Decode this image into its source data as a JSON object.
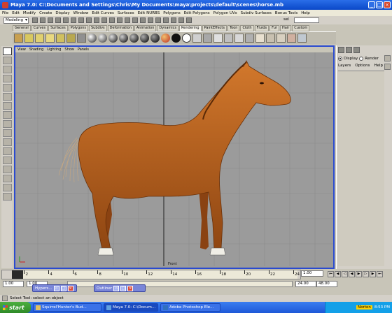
{
  "window": {
    "title": "Maya 7.0: C:\\Documents and Settings\\Chris\\My Documents\\maya\\projects\\default\\scenes\\horse.mb"
  },
  "menubar": [
    "File",
    "Edit",
    "Modify",
    "Create",
    "Display",
    "Window",
    "Edit Curves",
    "Surfaces",
    "Edit NURBS",
    "Polygons",
    "Edit Polygons",
    "Polygon UVs",
    "Subdiv Surfaces",
    "Bonus Tools",
    "Help"
  ],
  "statusline": {
    "mode": "Modeling",
    "set_label": "sel",
    "set_value": ""
  },
  "shelf_tabs": [
    "General",
    "Curves",
    "Surfaces",
    "Polygons",
    "Subdivs",
    "Deformation",
    "Animation",
    "Dynamics",
    "Rendering",
    "PaintEffects",
    "Toon",
    "Cloth",
    "Fluids",
    "Fur",
    "Hair",
    "Custom"
  ],
  "active_shelf_tab": "Rendering",
  "viewport": {
    "menu": [
      "View",
      "Shading",
      "Lighting",
      "Show",
      "Panels"
    ],
    "camera_label": "Front"
  },
  "channel_box": {
    "display_label": "Display",
    "render_label": "Render",
    "menu": [
      "Layers",
      "Options",
      "Help"
    ]
  },
  "time_slider": {
    "ticks": [
      "2",
      "4",
      "6",
      "8",
      "10",
      "12",
      "14",
      "16",
      "18",
      "20",
      "22",
      "24"
    ],
    "current_time": "1.00"
  },
  "range_slider": {
    "start": "1.00",
    "playback_start": "1.00",
    "playback_end": "24.00",
    "end": "48.00"
  },
  "minimized_windows": [
    {
      "label": "Hypers..."
    },
    {
      "label": "Outliner"
    }
  ],
  "helpline": {
    "text": "Select Tool: select an object"
  },
  "taskbar": {
    "start_label": "start",
    "items": [
      {
        "label": "Squirrel'Hunter's Bud..."
      },
      {
        "label": "Maya 7.0: C:\\Docum..."
      },
      {
        "label": "Adobe Photoshop Ele..."
      }
    ],
    "tray_norton": "Norton",
    "clock": "8:53 PM"
  },
  "colors": {
    "viewport_bg": "#9b9b9b",
    "horse_body": "#c0641e",
    "active_panel_border": "#2a4ad0",
    "taskbar": "#2563e0"
  }
}
